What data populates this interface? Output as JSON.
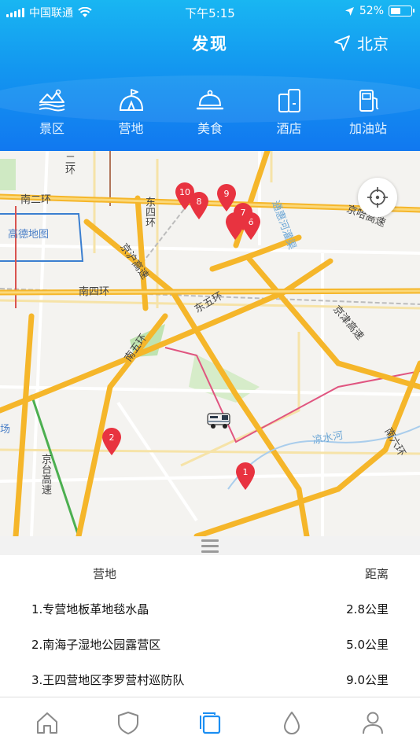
{
  "status_bar": {
    "carrier": "中国联通",
    "time": "下午5:15",
    "battery_text": "52%",
    "battery_level": 0.52
  },
  "header": {
    "title": "发现",
    "city": "北京"
  },
  "categories": [
    {
      "label": "景区",
      "icon": "scenic-icon"
    },
    {
      "label": "营地",
      "icon": "campsite-icon"
    },
    {
      "label": "美食",
      "icon": "food-icon"
    },
    {
      "label": "酒店",
      "icon": "hotel-icon"
    },
    {
      "label": "加油站",
      "icon": "gas-station-icon"
    }
  ],
  "map": {
    "brand": "高德地图",
    "markers": [
      "10",
      "8",
      "9",
      "7",
      "6",
      "2",
      "1"
    ],
    "labels": {
      "south_2nd_ring": "南二环",
      "east_4th_ring": "东四环",
      "south_4th_ring": "南四环",
      "east_5th_ring": "东五环",
      "south_5th_ring": "南五环",
      "south_6th_ring": "南六环",
      "jinghu_expressway": "京沪高速",
      "jingha_expressway": "京哈高速",
      "jingjin_expressway": "京津高速",
      "jingtai_expressway": "京台高速",
      "tonghui_canal": "通惠河灌渠",
      "liangshui_river": "凉水河",
      "ring_top": "二环",
      "field_partial": "场"
    },
    "colors": {
      "accent": "#1b8ef2",
      "marker": "#e83340",
      "expressway": "#f5b62a"
    }
  },
  "list": {
    "col_name": "营地",
    "col_distance": "距离",
    "rows": [
      {
        "name": "1.专营地板革地毯水晶",
        "distance": "2.8公里"
      },
      {
        "name": "2.南海子湿地公园露营区",
        "distance": "5.0公里"
      },
      {
        "name": "3.王四营地区李罗营村巡防队",
        "distance": "9.0公里"
      }
    ]
  },
  "tabbar": {
    "items": [
      {
        "icon": "home-icon",
        "active": false
      },
      {
        "icon": "shield-icon",
        "active": false
      },
      {
        "icon": "copy-icon",
        "active": true
      },
      {
        "icon": "drop-icon",
        "active": false
      },
      {
        "icon": "user-icon",
        "active": false
      }
    ]
  }
}
